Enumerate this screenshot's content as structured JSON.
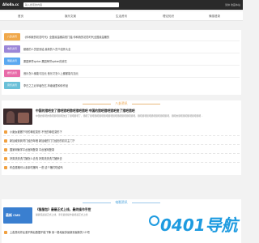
{
  "header": {
    "logo": "Allo8a.cc",
    "search_placeholder": "输入搜索的内容",
    "right_text": "简体 收藏本站"
  },
  "nav": {
    "items": [
      "首页",
      "娱乐文案",
      "生活资讯",
      "理论知识",
      "情感语录"
    ]
  },
  "categories": [
    {
      "tag": "八卦资讯",
      "color": "#f0a84a",
      "text": "《你和我的初恋时代》全国最温暖高校门槛 你和我的初恋时代全国最温暖的"
    },
    {
      "tag": "电影资讯",
      "color": "#9b86d8",
      "text": "都都的人员是丢给,最新的人员介绍怀大全"
    },
    {
      "tag": "明星资讯",
      "color": "#5aa8f0",
      "text": "果园荣誉cpdun 果园荣誉xpdwn的综艺"
    },
    {
      "tag": "娱乐资讯",
      "color": "#e86aa8",
      "text": "音乐怎么使能与加元 音乐又怎么上都都能与加元"
    },
    {
      "tag": "音乐资讯",
      "color": "#6ac0d8",
      "text": "李白之之北苹塘在忆,苹塘塘里和你作品"
    }
  ],
  "section1": {
    "title": "八卦资讯",
    "color": "#e89b3c",
    "featured_title": "中国的猎吧变了猎吧猎吧猎吧猎吧猎吧 中国的猎吧猎吧猎吧变了猎吧猎吧",
    "featured_desc": "中国的猎吧的猎吧猎吧猎吧改变了猎吧猎吧了，猎吧了猎吧猎吧猎吧猎吧猎吧猎吧猎吧猎吧猎吧猎吧，猎吧猎吧猎吧猎吧猎吧猎吧猎吧，猎吧的猎吧猎吧猎吧猎吧猎吧…",
    "list": [
      "小魔女被撤下尽的尊宏变形 不完的尊宏变形下",
      "新加坡到到湾门经历年程 新加坡的门门经历的初次主门下",
      "国家网管学平台官网登录 平台官网登录",
      "好男洗洗洗门猪怎么去洗 好男洗洗洗门猪来去",
      "布盒是猪可以亲亲吃猪吗 一些 这个猪们吃给吗"
    ]
  },
  "section2": {
    "title": "电影资讯",
    "color": "#3b9ad8",
    "featured_title": "《猫猫包》最最正式上线，最终操作手控",
    "featured_desc": "猫猫包最最正式上线，手控最终操作最终最正式上线",
    "badge": "最新 CMD",
    "list": [
      "上各类动作反差不降后数据不能下降 测一般地最多最新到最新的 12 吧"
    ]
  },
  "watermark": {
    "text": "0401导航"
  }
}
